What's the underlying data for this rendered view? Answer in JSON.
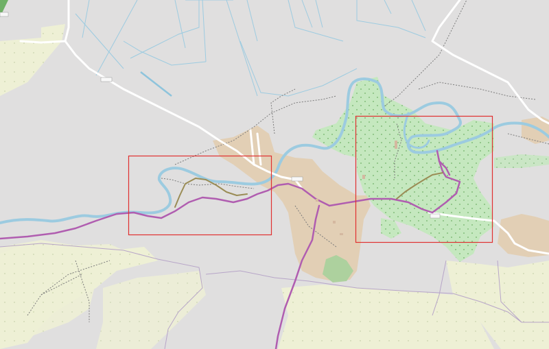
{
  "map": {
    "kind": "openstreetmap-tile-render",
    "colors": {
      "background": "#e0dfdf",
      "farmland": "#eef0d5",
      "forest": "#add19e",
      "wetland_meadow": "#aedfa3",
      "residential": "#e2cfb5",
      "water": "#aad3df",
      "river_stroke": "#9ccbe0",
      "highway_primary": "#ffffff",
      "route_purple": "#b05db0",
      "route_olive": "#9a8c55",
      "selection_box": "#e03030",
      "boundary": "#b7a5c8",
      "track": "#7a7a7a"
    },
    "highlight_boxes_count": 2,
    "road_shields": [
      "",
      "",
      "",
      ""
    ]
  }
}
